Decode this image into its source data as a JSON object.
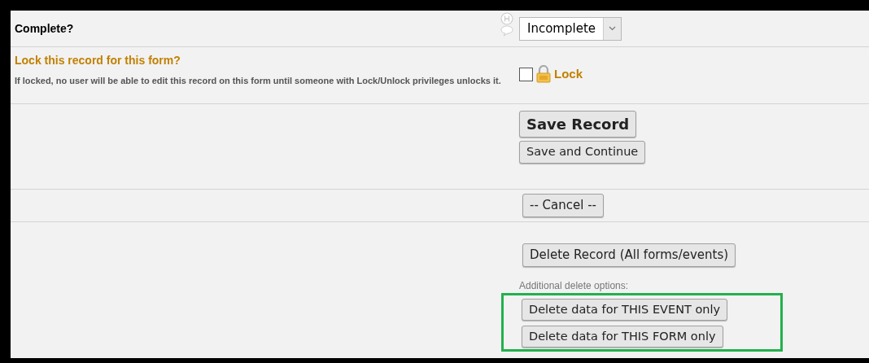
{
  "complete": {
    "label": "Complete?",
    "select": {
      "value": "Incomplete"
    }
  },
  "lock": {
    "title": "Lock this record for this form?",
    "note": "If locked, no user will be able to edit this record on this form until someone with Lock/Unlock privileges unlocks it.",
    "checkbox": {
      "checked": false,
      "label": "Lock"
    }
  },
  "save_buttons": [
    {
      "label": "Save Record",
      "kind": "primary"
    },
    {
      "label": "Save and Continue",
      "kind": "normal"
    }
  ],
  "cancel_button": "-- Cancel --",
  "delete": {
    "button": "Delete Record (All forms/events)",
    "additional_label": "Additional delete options:",
    "highlighted": true,
    "options": [
      "Delete data for THIS EVENT only",
      "Delete data for THIS FORM only"
    ]
  }
}
